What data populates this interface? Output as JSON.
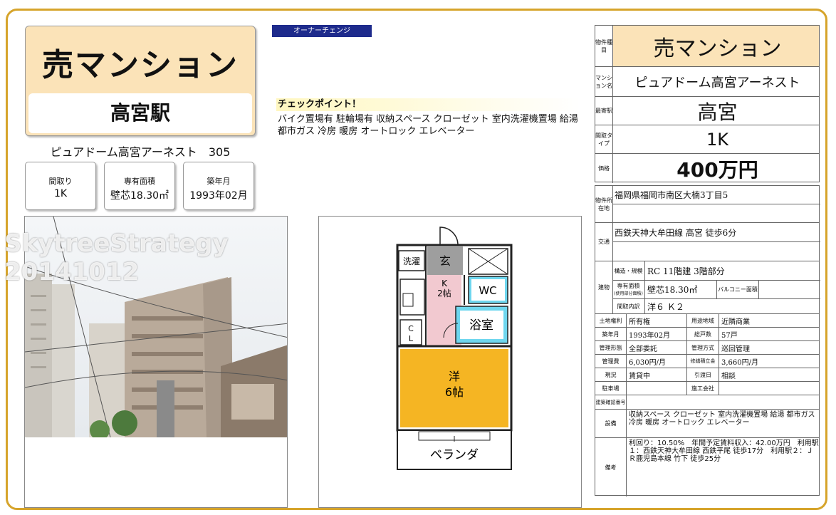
{
  "header": {
    "title": "売マンション",
    "station": "高宮駅",
    "property_name": "ピュアドーム高宮アーネスト　305"
  },
  "summary_cards": [
    {
      "label": "間取り",
      "value": "1K"
    },
    {
      "label": "専有面積",
      "value": "壁芯18.30㎡"
    },
    {
      "label": "築年月",
      "value": "1993年02月"
    }
  ],
  "badge": "オーナーチェンジ",
  "checkpoint": {
    "heading": "チェックポイント！",
    "text": "バイク置場有 駐輪場有 収納スペース クローゼット 室内洗濯機置場 給湯 都市ガス 冷房 暖房 オートロック エレベーター"
  },
  "watermark": {
    "line1": "SkytreeStrategy",
    "line2": "20141012"
  },
  "floorplan": {
    "senmen": "洗濯",
    "genkan": "玄",
    "kitchen": "K",
    "kitchen_size": "2帖",
    "wc": "WC",
    "bath": "浴室",
    "cl1": "C",
    "cl2": "L",
    "room": "洋",
    "room_size": "6帖",
    "veranda": "ベランダ"
  },
  "summary_table": {
    "type_label": "物件種目",
    "type_value": "売マンション",
    "name_label": "マンション名",
    "name_value": "ピュアドーム高宮アーネスト",
    "station_label": "最寄駅",
    "station_value": "高宮",
    "layout_label": "間取タイプ",
    "layout_value": "1K",
    "price_label": "価格",
    "price_value": "400万円"
  },
  "detail_table": {
    "address_label": "物件所在地",
    "address": "福岡県福岡市南区大楠3丁目5",
    "transport_label": "交通",
    "transport": "西鉄天神大牟田線 高宮 徒歩6分",
    "building_label": "建物",
    "structure_label": "構造・規模",
    "structure": "RC 11階建 3階部分",
    "area_label": "専有面積",
    "area_sub": "(使用部分面積)",
    "area": "壁芯18.30㎡",
    "balcony_label": "バルコニー面積",
    "balcony": "",
    "rooms_label": "間取内訳",
    "rooms": "洋６ Ｋ２",
    "land_right_label": "土地権利",
    "land_right": "所有権",
    "zoning_label": "用途地域",
    "zoning": "近隣商業",
    "built_label": "築年月",
    "built": "1993年02月",
    "units_label": "総戸数",
    "units": "57戸",
    "mgmt_form_label": "管理形態",
    "mgmt_form": "全部委託",
    "mgmt_method_label": "管理方式",
    "mgmt_method": "巡回管理",
    "mgmt_fee_label": "管理費",
    "mgmt_fee": "6,030円/月",
    "repair_label": "修繕積立金",
    "repair": "3,660円/月",
    "status_label": "現況",
    "status": "賃貸中",
    "handover_label": "引渡日",
    "handover": "相談",
    "parking_label": "駐車場",
    "parking": "",
    "builder_label": "施工会社",
    "builder": "",
    "confirm_label": "建築確認番号",
    "confirm": "",
    "equipment_label": "設備",
    "equipment": "収納スペース クローゼット 室内洗濯機置場 給湯 都市ガス 冷房 暖房 オートロック エレベーター",
    "remarks_label": "備考",
    "remarks": "利回り：10.50%　年間予定賃料収入：42.00万円　利用駅１：西鉄天神大牟田線 西鉄平尾 徒歩17分　利用駅２：ＪＲ鹿児島本線 竹下 徒歩25分"
  }
}
